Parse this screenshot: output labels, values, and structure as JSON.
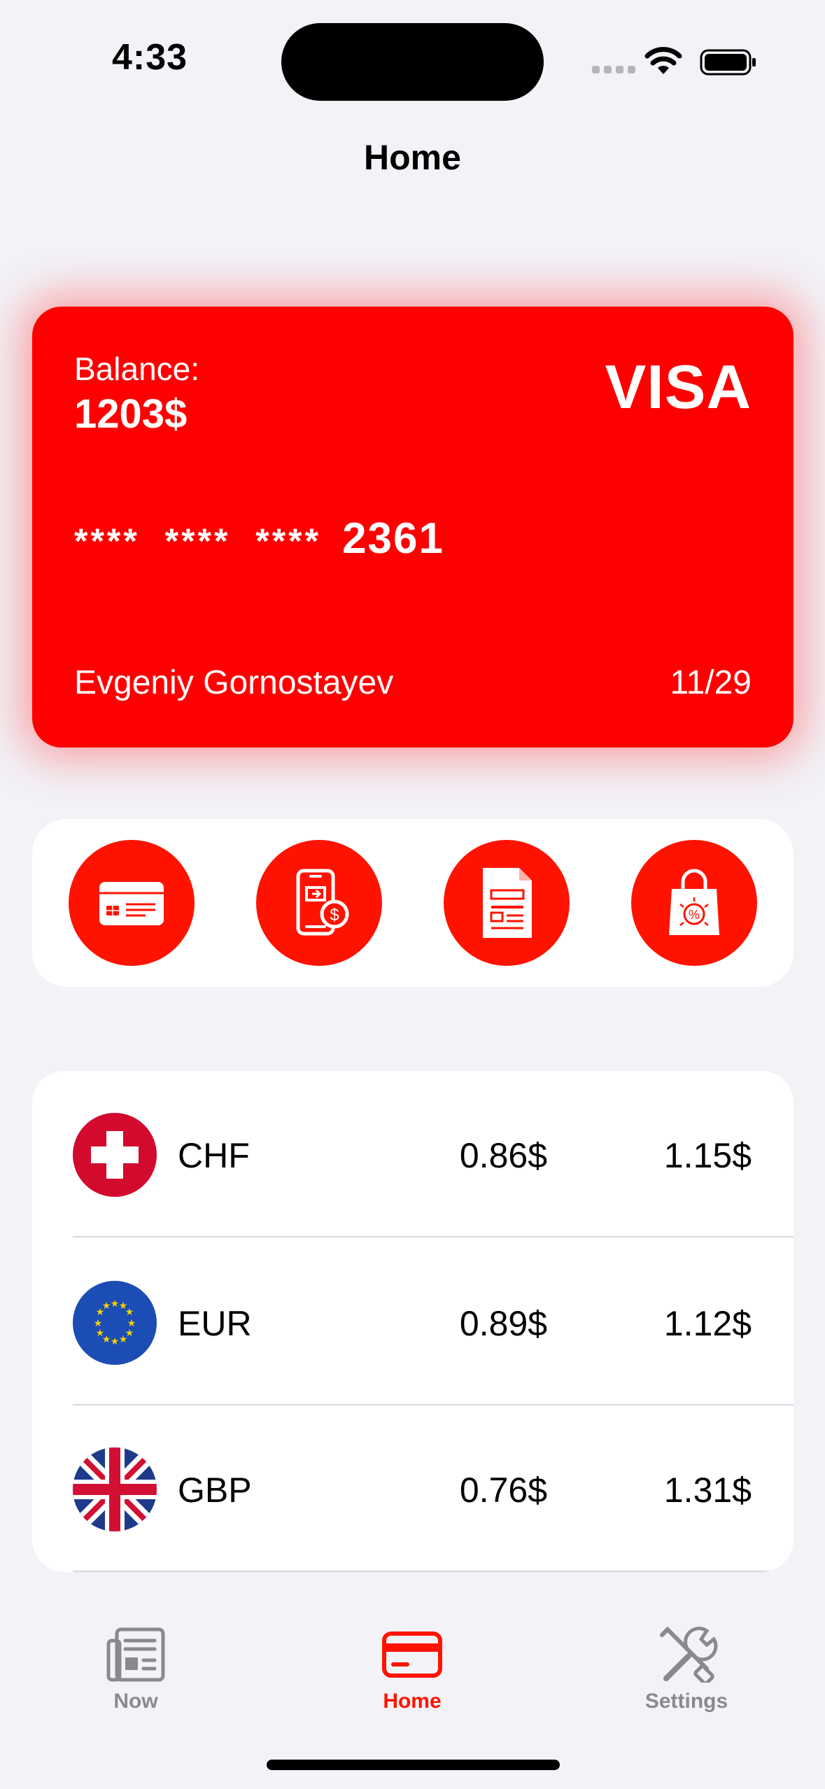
{
  "status_bar": {
    "time": "4:33"
  },
  "nav": {
    "title": "Home"
  },
  "card": {
    "balance_label": "Balance:",
    "balance_value": "1203$",
    "brand": "VISA",
    "number_mask": "****  ****  ****",
    "number_last4": "2361",
    "holder": "Evgeniy Gornostayev",
    "expiry": "11/29",
    "color": "#FF0000"
  },
  "actions": [
    {
      "icon": "credit-card-icon"
    },
    {
      "icon": "mobile-payment-icon"
    },
    {
      "icon": "document-icon"
    },
    {
      "icon": "shopping-bag-discount-icon"
    }
  ],
  "rates": [
    {
      "code": "CHF",
      "buy": "0.86$",
      "sell": "1.15$",
      "flag": "switzerland-flag-icon"
    },
    {
      "code": "EUR",
      "buy": "0.89$",
      "sell": "1.12$",
      "flag": "eu-flag-icon"
    },
    {
      "code": "GBP",
      "buy": "0.76$",
      "sell": "1.31$",
      "flag": "uk-flag-icon"
    }
  ],
  "tab_bar": {
    "tabs": [
      {
        "label": "Now",
        "icon": "newspaper-icon",
        "active": false
      },
      {
        "label": "Home",
        "icon": "card-icon",
        "active": true
      },
      {
        "label": "Settings",
        "icon": "tools-icon",
        "active": false
      }
    ],
    "active_color": "#FF1300",
    "inactive_color": "#8A8A8E"
  }
}
